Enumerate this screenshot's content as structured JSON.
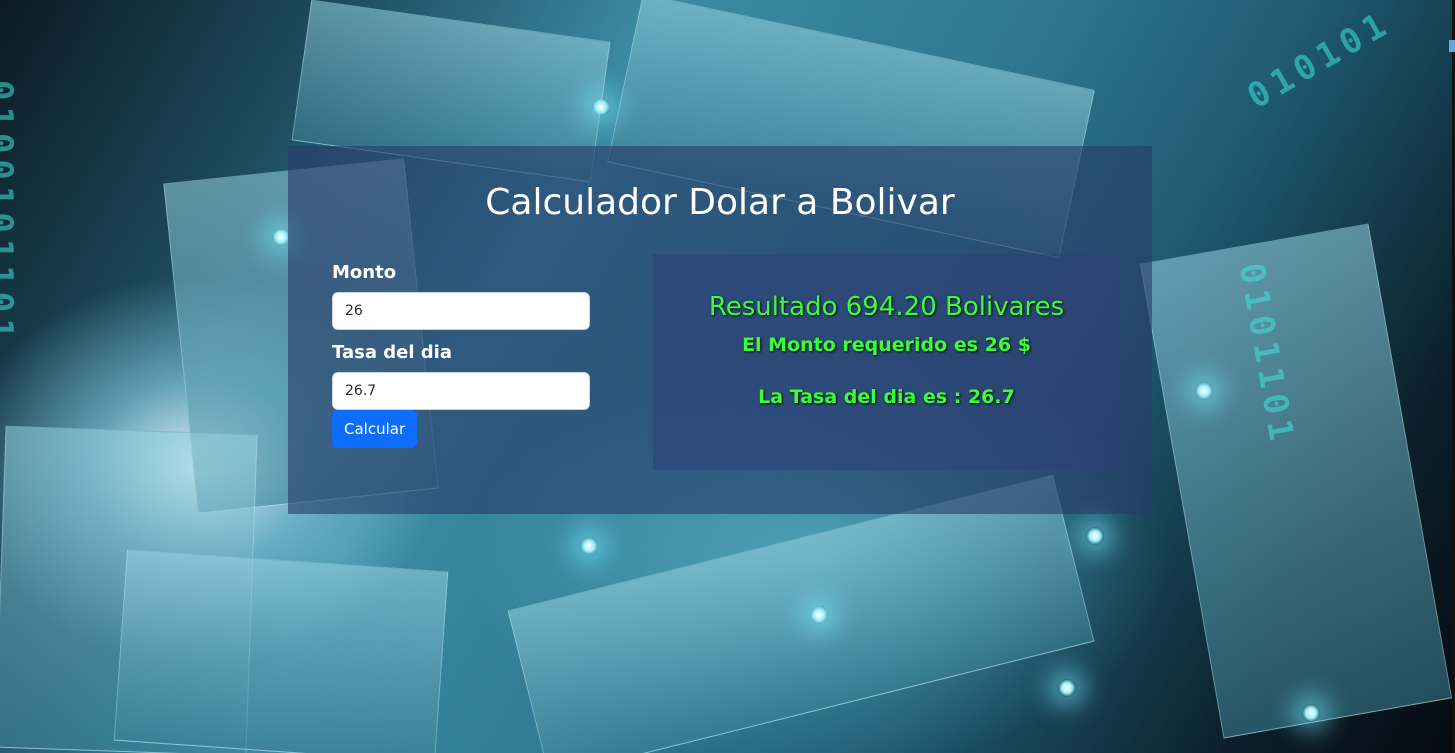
{
  "title": "Calculador Dolar a Bolivar",
  "form": {
    "monto_label": "Monto",
    "monto_value": "26",
    "tasa_label": "Tasa del dia",
    "tasa_value": "26.7",
    "submit_label": "Calcular"
  },
  "result": {
    "main": "Resultado 694.20 Bolivares",
    "monto_line": "El Monto requerido es 26 $",
    "tasa_line": "La Tasa del dia es : 26.7"
  },
  "colors": {
    "result_text": "#39ff39",
    "button": "#0d6efd",
    "card_overlay": "#283c69"
  }
}
